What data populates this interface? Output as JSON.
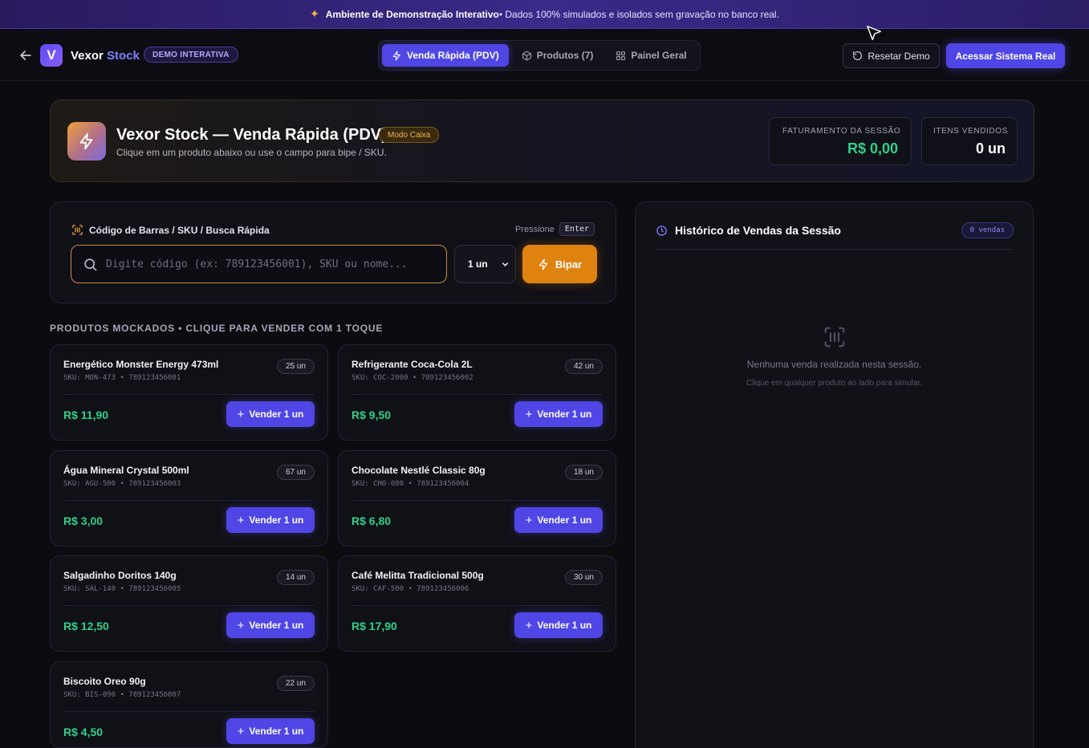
{
  "banner": {
    "title": "Ambiente de Demonstração Interativo",
    "text": " • Dados 100% simulados e isolados sem gravação no banco real.",
    "icon": "sparkle-icon"
  },
  "navbar": {
    "logo_letter": "V",
    "brand_main": "Vexor",
    "brand_accent": "Stock",
    "badge": "DEMO INTERATIVA",
    "tabs": [
      {
        "label": "Venda Rápida (PDV)",
        "icon": "lightning-icon",
        "active": true
      },
      {
        "label": "Produtos (7)",
        "icon": "box-icon",
        "active": false
      },
      {
        "label": "Painel Geral",
        "icon": "grid-icon",
        "active": false
      }
    ],
    "reset_label": "Resetar Demo",
    "access_label": "Acessar Sistema Real"
  },
  "hero": {
    "title": "Vexor Stock — Venda Rápida (PDV)",
    "mode_badge": "Modo Caixa",
    "subtitle": "Clique em um produto abaixo ou use o campo para bipe / SKU.",
    "revenue_label": "FATURAMENTO DA SESSÃO",
    "revenue_value": "R$ 0,00",
    "items_label": "ITENS VENDIDOS",
    "items_value": "0 un"
  },
  "scanner": {
    "label": "Código de Barras / SKU / Busca Rápida",
    "press_label": "Pressione",
    "key": "Enter",
    "placeholder": "Digite código (ex: 789123456001), SKU ou nome...",
    "qty_value": "1 un",
    "button_label": "Bipar"
  },
  "products_section": {
    "title": "PRODUTOS MOCKADOS • CLIQUE PARA VENDER COM 1 TOQUE",
    "sell_label": "Vender 1 un",
    "items": [
      {
        "name": "Energético Monster Energy 473ml",
        "sku": "SKU: MON-473 • 789123456001",
        "stock": "25 un",
        "price": "R$ 11,90"
      },
      {
        "name": "Refrigerante Coca-Cola 2L",
        "sku": "SKU: COC-2000 • 789123456002",
        "stock": "42 un",
        "price": "R$ 9,50"
      },
      {
        "name": "Água Mineral Crystal 500ml",
        "sku": "SKU: AGU-500 • 789123456003",
        "stock": "67 un",
        "price": "R$ 3,00"
      },
      {
        "name": "Chocolate Nestlé Classic 80g",
        "sku": "SKU: CHO-080 • 789123456004",
        "stock": "18 un",
        "price": "R$ 6,80"
      },
      {
        "name": "Salgadinho Doritos 140g",
        "sku": "SKU: SAL-140 • 789123456005",
        "stock": "14 un",
        "price": "R$ 12,50"
      },
      {
        "name": "Café Melitta Tradicional 500g",
        "sku": "SKU: CAF-500 • 789123456006",
        "stock": "30 un",
        "price": "R$ 17,90"
      },
      {
        "name": "Biscoito Oreo 90g",
        "sku": "SKU: BIS-090 • 789123456007",
        "stock": "22 un",
        "price": "R$ 4,50"
      }
    ]
  },
  "history": {
    "title": "Histórico de Vendas da Sessão",
    "count": "0 vendas",
    "empty_main": "Nenhuma venda realizada nesta sessão.",
    "empty_sub": "Clique em qualquer produto ao lado para simular."
  }
}
